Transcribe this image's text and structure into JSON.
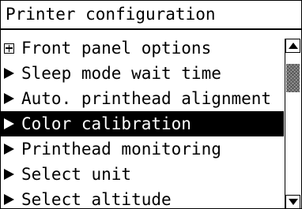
{
  "header": {
    "title": "Printer configuration"
  },
  "menu": {
    "items": [
      {
        "label": "Front panel options",
        "marker": "expand-plus-icon",
        "selected": false
      },
      {
        "label": "Sleep mode wait time",
        "marker": "right-triangle-icon",
        "selected": false
      },
      {
        "label": "Auto. printhead alignment",
        "marker": "right-triangle-icon",
        "selected": false
      },
      {
        "label": "Color calibration",
        "marker": "right-triangle-icon",
        "selected": true
      },
      {
        "label": "Printhead monitoring",
        "marker": "right-triangle-icon",
        "selected": false
      },
      {
        "label": "Select unit",
        "marker": "right-triangle-icon",
        "selected": false
      },
      {
        "label": "Select altitude",
        "marker": "right-triangle-icon",
        "selected": false
      }
    ]
  },
  "scrollbar": {
    "position_fraction": 0.08,
    "visible_fraction": 0.2,
    "up_icon": "scroll-up-arrow-icon",
    "down_icon": "scroll-down-arrow-icon"
  },
  "colors": {
    "foreground": "#000000",
    "background": "#ffffff",
    "selection_background": "#000000",
    "selection_text": "#ffffff",
    "scroll_thumb": "#9a9a9a"
  }
}
